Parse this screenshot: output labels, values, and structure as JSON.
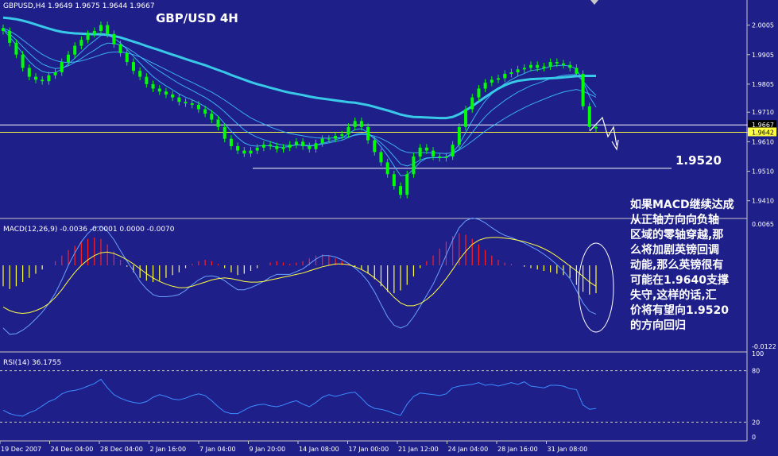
{
  "symbol_header": "GBPUSD,H4  1.9649 1.9675 1.9644 1.9667",
  "chart_title": "GBP/USD 4H",
  "annotation_level": "1.9520",
  "comment_lines": [
    "如果MACD继续达成",
    "从正轴方向向负轴",
    "区域的零轴穿越,那",
    "么将加剧英镑回调",
    "动能,那么英镑很有",
    "可能在1.9640支撑",
    "失守,这样的话,汇",
    "价将有望向1.9520",
    "的方向回归"
  ],
  "macd_header": "MACD(12,26,9) -0.0036 -0.0001 0.0000 -0.0070",
  "rsi_header": "RSI(14) 36.1755",
  "price_axis_labels": [
    "2.0005",
    "1.9905",
    "1.9805",
    "1.9710",
    "1.9667",
    "1.9642",
    "1.9610",
    "1.9510",
    "1.9410"
  ],
  "macd_axis_labels": [
    "0.0065",
    "-0.0122"
  ],
  "rsi_axis_labels": [
    "100",
    "80",
    "20",
    "0"
  ],
  "colors": {
    "background": "#1f1f8a",
    "grid": "#c8c8c8",
    "candle": "#00ff00",
    "ema": "#40c8ff",
    "ema_long": "#38c8e8",
    "signal": "#ffff40",
    "macd_line": "#6aa0ff",
    "hist_pos": "#ff2020",
    "hist_neg": "#ffff40",
    "rsi": "#3c8cff",
    "level_line": "#ffffff",
    "price_line": "#ffff40"
  },
  "chart_data": [
    {
      "type": "candlestick",
      "title": "GBP/USD 4H",
      "ylim": [
        1.935,
        2.009
      ],
      "price_lines": [
        1.9667,
        1.9642
      ],
      "support_line": 1.952,
      "x": [
        "19 Dec 2007",
        "24 Dec 04:00",
        "28 Dec 04:00",
        "2 Jan 16:00",
        "7 Jan 04:00",
        "9 Jan 20:00",
        "14 Jan 08:00",
        "17 Jan 00:00",
        "21 Jan 12:00",
        "24 Jan 04:00",
        "28 Jan 16:00",
        "31 Jan 08:00"
      ],
      "series": [
        {
          "values": [
            1.9985,
            1.9945,
            1.9905,
            1.986,
            1.983,
            1.982,
            1.9815,
            1.9835,
            1.9845,
            1.988,
            1.9905,
            1.9935,
            1.9955,
            1.9975,
            1.9985,
            2.0005,
            1.9975,
            1.994,
            1.991,
            1.988,
            1.985,
            1.983,
            1.9805,
            1.979,
            1.978,
            1.977,
            1.976,
            1.9745,
            1.974,
            1.9735,
            1.972,
            1.9705,
            1.9685,
            1.966,
            1.962,
            1.9595,
            1.958,
            1.957,
            1.958,
            1.959,
            1.96,
            1.9595,
            1.9585,
            1.959,
            1.96,
            1.961,
            1.9595,
            1.9585,
            1.9605,
            1.962,
            1.962,
            1.963,
            1.9635,
            1.966,
            1.968,
            1.966,
            1.9615,
            1.9575,
            1.954,
            1.95,
            1.946,
            1.943,
            1.95,
            1.956,
            1.959,
            1.958,
            1.956,
            1.9555,
            1.956,
            1.96,
            1.966,
            1.972,
            1.976,
            1.979,
            1.981,
            1.982,
            1.9825,
            1.984,
            1.9845,
            1.9855,
            1.986,
            1.987,
            1.986,
            1.9865,
            1.988,
            1.9875,
            1.987,
            1.986,
            1.984,
            1.973,
            1.966,
            1.9655
          ]
        },
        {
          "name": "EMA",
          "values": [
            1.999,
            1.9965,
            1.9938,
            1.9909,
            1.9882,
            1.9862,
            1.9848,
            1.9843,
            1.9844,
            1.9856,
            1.9873,
            1.9893,
            1.9914,
            1.9935,
            1.9952,
            1.997,
            1.9972,
            1.9961,
            1.9944,
            1.9923,
            1.9899,
            1.9876,
            1.9852,
            1.9831,
            1.9814,
            1.9799,
            1.9786,
            1.9772,
            1.9761,
            1.9752,
            1.9741,
            1.9729,
            1.9714,
            1.9696,
            1.9671,
            1.9646,
            1.9624,
            1.9606,
            1.9597,
            1.9595,
            1.9597,
            1.9596,
            1.9592,
            1.9591,
            1.9594,
            1.96,
            1.9598,
            1.9594,
            1.9598,
            1.9605,
            1.961,
            1.9617,
            1.9623,
            1.9637,
            1.9651,
            1.9654,
            1.9641,
            1.9619,
            1.9593,
            1.9562,
            1.9528,
            1.9495,
            1.9497,
            1.9517,
            1.9541,
            1.9554,
            1.9556,
            1.9556,
            1.9558,
            1.9572,
            1.9601,
            1.9641,
            1.9681,
            1.9717,
            1.9748,
            1.9772,
            1.979,
            1.9807,
            1.982,
            1.9832,
            1.9841,
            1.9851,
            1.9854,
            1.9858,
            1.9865,
            1.9868,
            1.9869,
            1.9866,
            1.9857,
            1.9815,
            1.9763,
            1.9727
          ]
        },
        {
          "name": "EMA",
          "values": [
            1.9992,
            1.9975,
            1.9955,
            1.9932,
            1.991,
            1.989,
            1.9873,
            1.9864,
            1.9858,
            1.986,
            1.9867,
            1.9879,
            1.9892,
            1.9907,
            1.992,
            1.9935,
            1.9944,
            1.9943,
            1.9938,
            1.9928,
            1.9914,
            1.9898,
            1.9881,
            1.9864,
            1.9849,
            1.9835,
            1.9821,
            1.9807,
            1.9795,
            1.9784,
            1.9772,
            1.976,
            1.9746,
            1.973,
            1.9711,
            1.969,
            1.967,
            1.965,
            1.9636,
            1.9625,
            1.9617,
            1.961,
            1.9603,
            1.9598,
            1.9597,
            1.9599,
            1.9599,
            1.9597,
            1.9598,
            1.9602,
            1.9606,
            1.9611,
            1.9615,
            1.9624,
            1.9634,
            1.9639,
            1.9635,
            1.9623,
            1.9606,
            1.9585,
            1.956,
            1.9534,
            1.9528,
            1.9535,
            1.9548,
            1.9555,
            1.9556,
            1.9556,
            1.9557,
            1.9566,
            1.9585,
            1.9612,
            1.9641,
            1.9669,
            1.9695,
            1.9716,
            1.9733,
            1.975,
            1.9764,
            1.9778,
            1.9789,
            1.98,
            1.9807,
            1.9815,
            1.9824,
            1.983,
            1.9835,
            1.9837,
            1.9837,
            1.9816,
            1.9789,
            1.9767
          ]
        },
        {
          "name": "EMA",
          "values": [
            1.9995,
            1.9985,
            1.9972,
            1.9955,
            1.9938,
            1.9921,
            1.9906,
            1.9894,
            1.9885,
            1.988,
            1.9878,
            1.988,
            1.9884,
            1.989,
            1.9897,
            1.9905,
            1.9911,
            1.9914,
            1.9914,
            1.9911,
            1.9905,
            1.9897,
            1.9887,
            1.9876,
            1.9865,
            1.9854,
            1.9843,
            1.9832,
            1.9821,
            1.9811,
            1.98,
            1.9789,
            1.9778,
            1.9765,
            1.9751,
            1.9736,
            1.972,
            1.9705,
            1.9691,
            1.968,
            1.967,
            1.966,
            1.9652,
            1.9644,
            1.9638,
            1.9634,
            1.963,
            1.9626,
            1.9623,
            1.9622,
            1.9622,
            1.9623,
            1.9624,
            1.9627,
            1.9632,
            1.9635,
            1.9634,
            1.9629,
            1.9621,
            1.961,
            1.9597,
            1.9582,
            1.9574,
            1.9572,
            1.9573,
            1.9573,
            1.9572,
            1.9571,
            1.957,
            1.9573,
            1.9582,
            1.9596,
            1.9612,
            1.9629,
            1.9646,
            1.9661,
            1.9675,
            1.9689,
            1.9702,
            1.9714,
            1.9725,
            1.9736,
            1.9745,
            1.9754,
            1.9763,
            1.9771,
            1.9778,
            1.9783,
            1.9787,
            1.9781,
            1.9771,
            1.9761
          ]
        },
        {
          "name": "EMA",
          "values": [
            2.003,
            2.0028,
            2.0025,
            2.002,
            2.0014,
            2.0007,
            2.0,
            1.9993,
            1.9987,
            1.9982,
            1.9979,
            1.9977,
            1.9976,
            1.9975,
            1.9974,
            1.9974,
            1.9972,
            1.9968,
            1.9963,
            1.9956,
            1.9949,
            1.9942,
            1.9934,
            1.9927,
            1.992,
            1.9912,
            1.9905,
            1.9898,
            1.989,
            1.9883,
            1.9876,
            1.9869,
            1.9861,
            1.9853,
            1.9845,
            1.9836,
            1.9828,
            1.982,
            1.9812,
            1.9805,
            1.9799,
            1.9793,
            1.9787,
            1.9781,
            1.9776,
            1.9772,
            1.9768,
            1.9763,
            1.9759,
            1.9756,
            1.9753,
            1.975,
            1.9747,
            1.9744,
            1.9742,
            1.9738,
            1.9734,
            1.9728,
            1.9722,
            1.9716,
            1.9709,
            1.9702,
            1.9697,
            1.9694,
            1.9693,
            1.9692,
            1.9691,
            1.969,
            1.969,
            1.9694,
            1.9703,
            1.9716,
            1.973,
            1.9746,
            1.9761,
            1.9776,
            1.979,
            1.9801,
            1.981,
            1.9816,
            1.9819,
            1.9822,
            1.9823,
            1.9824,
            1.9825,
            1.9826,
            1.9828,
            1.983,
            1.9832,
            1.9833,
            1.9833,
            1.9833
          ]
        }
      ]
    },
    {
      "type": "bar",
      "title": "MACD(12,26,9)",
      "ylim": [
        -0.0122,
        0.0065
      ],
      "series": [
        {
          "name": "MACD histogram",
          "values": [
            -0.003,
            -0.0034,
            -0.003,
            -0.0024,
            -0.0018,
            -0.0012,
            -0.0006,
            0.0,
            0.0006,
            0.0014,
            0.0022,
            0.0028,
            0.0034,
            0.0038,
            0.004,
            0.0038,
            0.003,
            0.002,
            0.0008,
            -0.0002,
            -0.001,
            -0.0018,
            -0.0022,
            -0.0024,
            -0.0022,
            -0.0018,
            -0.0014,
            -0.001,
            -0.0004,
            0.0002,
            0.0006,
            0.0008,
            0.0006,
            0.0002,
            -0.0004,
            -0.001,
            -0.0014,
            -0.0012,
            -0.0008,
            -0.0004,
            0.0,
            0.0004,
            0.0006,
            0.0004,
            0.0002,
            0.0004,
            0.0006,
            0.001,
            0.0014,
            0.0016,
            0.0014,
            0.001,
            0.0006,
            0.0002,
            -0.0002,
            -0.0006,
            -0.0012,
            -0.002,
            -0.003,
            -0.0038,
            -0.004,
            -0.0036,
            -0.0028,
            -0.0016,
            -0.0004,
            0.0006,
            0.0014,
            0.0024,
            0.0034,
            0.0042,
            0.0046,
            0.0044,
            0.0038,
            0.003,
            0.0022,
            0.0014,
            0.0008,
            0.0004,
            0.0002,
            0.0,
            -0.0002,
            -0.0004,
            -0.0006,
            -0.0008,
            -0.001,
            -0.0012,
            -0.0014,
            -0.0018,
            -0.0028,
            -0.0038,
            -0.0042,
            -0.004
          ]
        },
        {
          "name": "Signal",
          "values": [
            -0.006,
            -0.0065,
            -0.0068,
            -0.0069,
            -0.0068,
            -0.0065,
            -0.0061,
            -0.0055,
            -0.0046,
            -0.0035,
            -0.0022,
            -0.001,
            0.0,
            0.0008,
            0.0014,
            0.0018,
            0.0019,
            0.0017,
            0.0013,
            0.0008,
            0.0002,
            -0.0005,
            -0.0012,
            -0.0018,
            -0.0023,
            -0.0027,
            -0.003,
            -0.0032,
            -0.0032,
            -0.003,
            -0.0027,
            -0.0024,
            -0.0021,
            -0.0019,
            -0.0018,
            -0.0019,
            -0.0021,
            -0.0023,
            -0.0024,
            -0.0024,
            -0.0023,
            -0.0021,
            -0.0019,
            -0.0017,
            -0.0015,
            -0.0013,
            -0.0011,
            -0.0008,
            -0.0005,
            -0.0002,
            0.0,
            0.0002,
            0.0002,
            0.0001,
            -0.0002,
            -0.0006,
            -0.0011,
            -0.0018,
            -0.0026,
            -0.0036,
            -0.0046,
            -0.0054,
            -0.0058,
            -0.0058,
            -0.0055,
            -0.0049,
            -0.0041,
            -0.0031,
            -0.0019,
            -0.0006,
            0.0008,
            0.002,
            0.003,
            0.0036,
            0.0039,
            0.004,
            0.004,
            0.0039,
            0.0038,
            0.0036,
            0.0034,
            0.0031,
            0.0028,
            0.0024,
            0.0019,
            0.0013,
            0.0006,
            -0.0001,
            -0.0008,
            -0.0016,
            -0.0024,
            -0.003
          ]
        },
        {
          "name": "MACD",
          "values": [
            -0.009,
            -0.0099,
            -0.0098,
            -0.0093,
            -0.0086,
            -0.0077,
            -0.0067,
            -0.0055,
            -0.004,
            -0.0021,
            0.0,
            0.0018,
            0.0034,
            0.0046,
            0.0054,
            0.0056,
            0.0049,
            0.0037,
            0.0021,
            0.0006,
            -0.0008,
            -0.0023,
            -0.0034,
            -0.0042,
            -0.0045,
            -0.0045,
            -0.0044,
            -0.0042,
            -0.0036,
            -0.0028,
            -0.0021,
            -0.0016,
            -0.0015,
            -0.0017,
            -0.0022,
            -0.0029,
            -0.0035,
            -0.0035,
            -0.0032,
            -0.0028,
            -0.0023,
            -0.0017,
            -0.0013,
            -0.0013,
            -0.0013,
            -0.0009,
            -0.0005,
            0.0002,
            0.0009,
            0.0014,
            0.0014,
            0.0012,
            0.0008,
            0.0003,
            -0.0004,
            -0.0012,
            -0.0023,
            -0.0038,
            -0.0056,
            -0.0074,
            -0.0086,
            -0.009,
            -0.0086,
            -0.0074,
            -0.0059,
            -0.0043,
            -0.0027,
            -0.0007,
            0.0015,
            0.0036,
            0.0054,
            0.0064,
            0.0068,
            0.0066,
            0.0061,
            0.0054,
            0.0048,
            0.0043,
            0.004,
            0.0036,
            0.0032,
            0.0027,
            0.0022,
            0.0016,
            0.0009,
            0.0001,
            -0.0008,
            -0.0019,
            -0.0036,
            -0.0054,
            -0.0066,
            -0.007
          ]
        }
      ]
    },
    {
      "type": "line",
      "title": "RSI(14)",
      "ylim": [
        0,
        100
      ],
      "levels": [
        80,
        20
      ],
      "series": [
        {
          "name": "RSI(14)",
          "values": [
            34,
            30,
            28,
            27,
            31,
            34,
            39,
            44,
            47,
            53,
            56,
            57,
            59,
            62,
            65,
            70,
            60,
            52,
            48,
            45,
            43,
            42,
            44,
            49,
            52,
            50,
            47,
            46,
            48,
            51,
            53,
            51,
            45,
            38,
            32,
            30,
            30,
            34,
            38,
            40,
            41,
            39,
            38,
            40,
            43,
            45,
            41,
            38,
            43,
            49,
            52,
            50,
            52,
            54,
            55,
            48,
            40,
            36,
            35,
            33,
            30,
            28,
            41,
            50,
            54,
            53,
            52,
            51,
            53,
            60,
            62,
            63,
            64,
            66,
            63,
            64,
            62,
            64,
            66,
            64,
            67,
            62,
            61,
            60,
            63,
            63,
            62,
            59,
            58,
            40,
            35,
            36
          ]
        }
      ]
    }
  ]
}
